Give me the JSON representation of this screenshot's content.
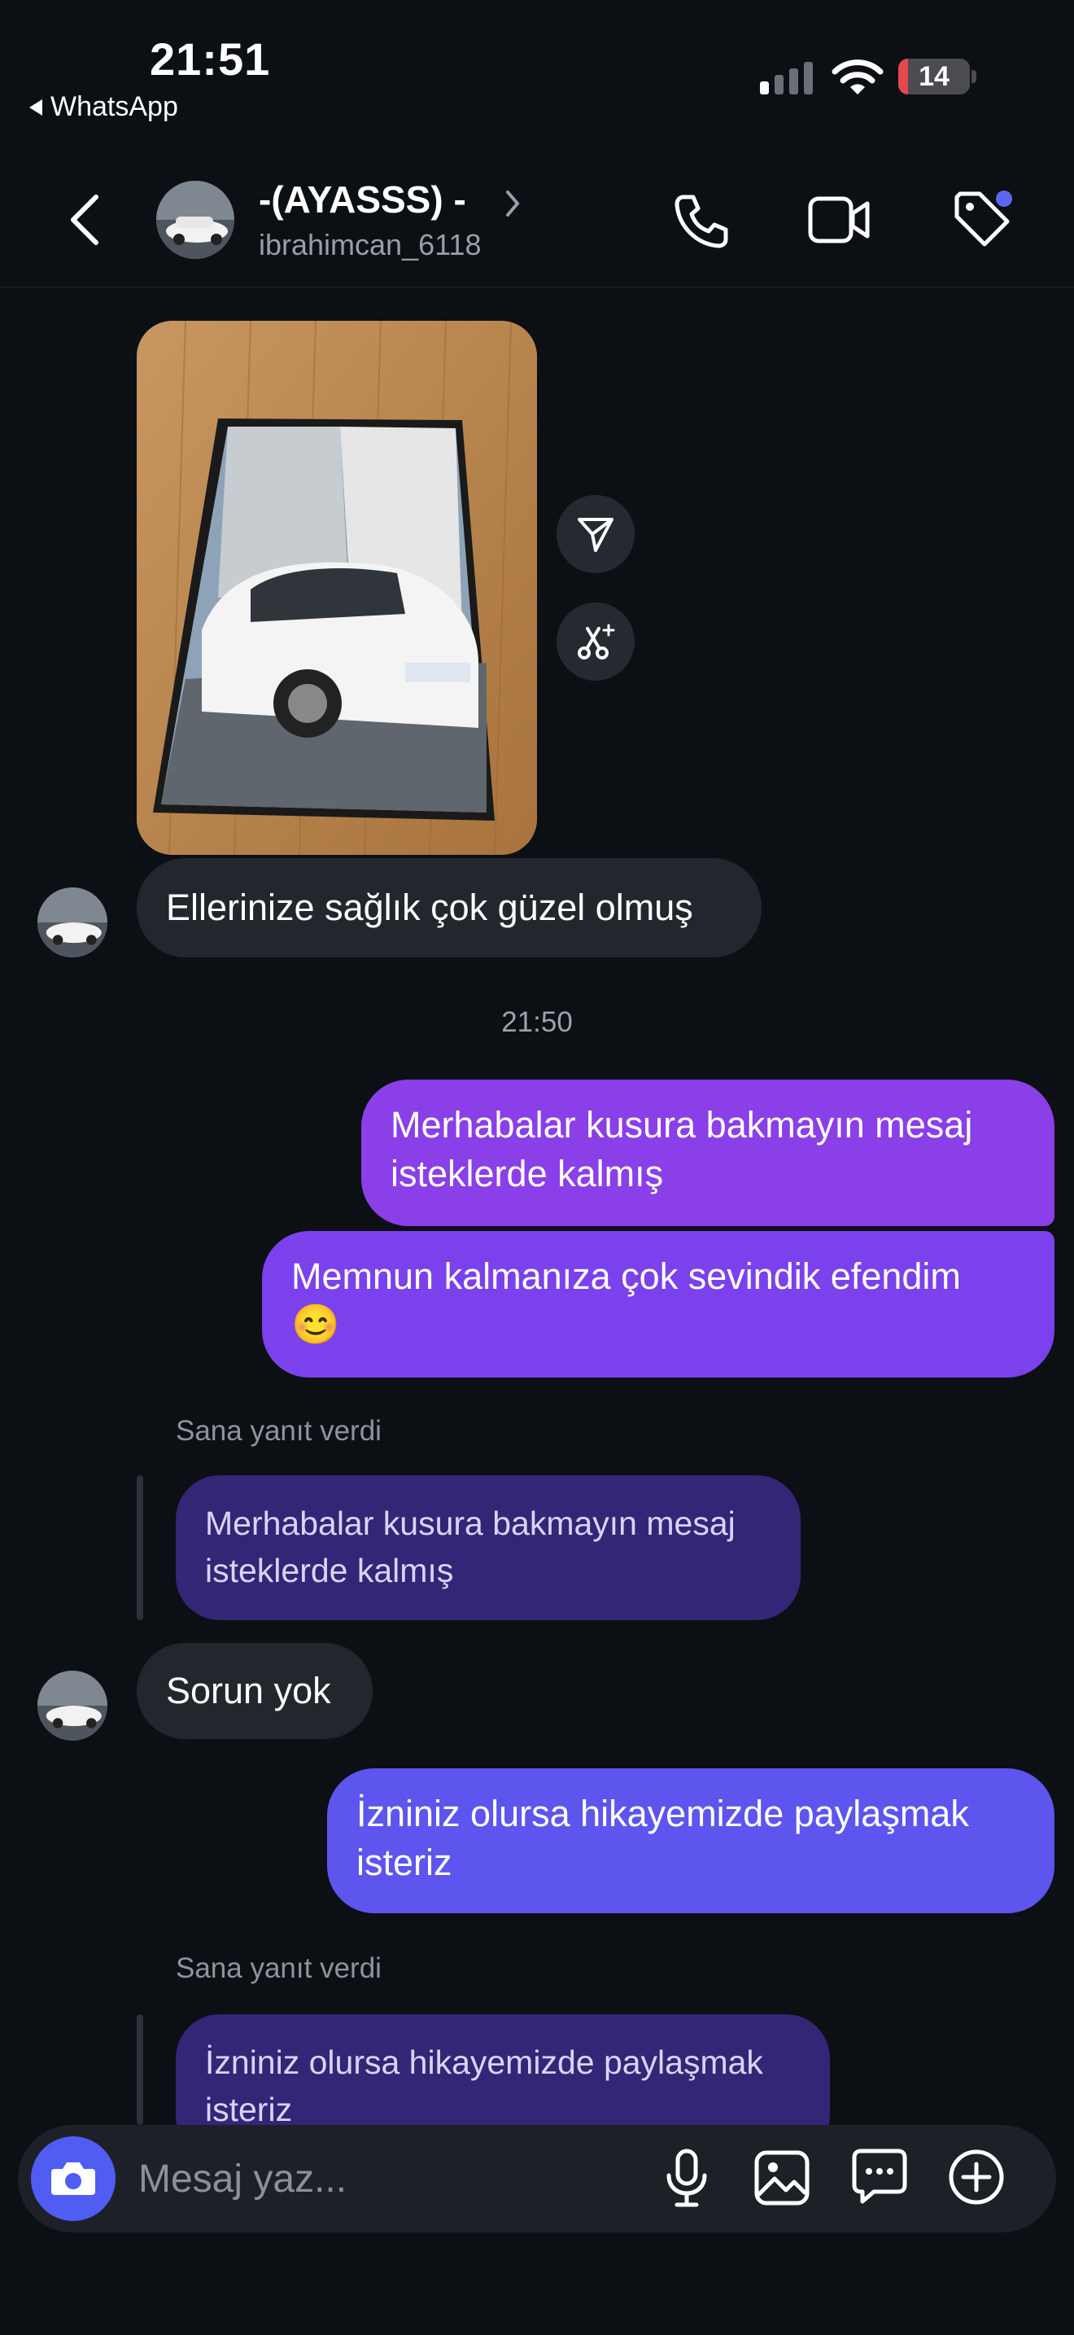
{
  "status_bar": {
    "time": "21:51",
    "back_app": "WhatsApp",
    "battery": "14",
    "battery_fraction": 0.14
  },
  "header": {
    "contact_name": "-(AYASSS) -",
    "username": "ibrahimcan_6118"
  },
  "messages": {
    "incoming_1": "Ellerinize sağlık çok güzel olmuş",
    "timestamp": "21:50",
    "outgoing_1": "Merhabalar kusura bakmayın mesaj isteklerde kalmış",
    "outgoing_2": "Memnun kalmanıza çok sevindik efendim",
    "outgoing_2_emoji": "😊",
    "reply_label_1": "Sana yanıt verdi",
    "quoted_1": "Merhabalar kusura bakmayın mesaj isteklerde kalmış",
    "incoming_2": "Sorun yok",
    "outgoing_3": "İzniniz olursa hikayemizde paylaşmak isteriz",
    "reply_label_2": "Sana yanıt verdi",
    "quoted_2": "İzniniz olursa hikayemizde paylaşmak isteriz"
  },
  "composer": {
    "placeholder": "Mesaj yaz..."
  },
  "colors": {
    "background": "#0c0f14",
    "incoming_bubble": "#23262d",
    "outgoing_top": "#8a3fe8",
    "outgoing_bottom": "#5d55ee",
    "quoted_bubble": "#332676",
    "accent": "#4f5df2"
  },
  "icons": [
    "back-chevron-icon",
    "phone-icon",
    "video-icon",
    "tag-icon",
    "send-icon",
    "scissors-sparkle-icon",
    "camera-icon",
    "microphone-icon",
    "gallery-icon",
    "sticker-chat-icon",
    "plus-circle-icon"
  ]
}
